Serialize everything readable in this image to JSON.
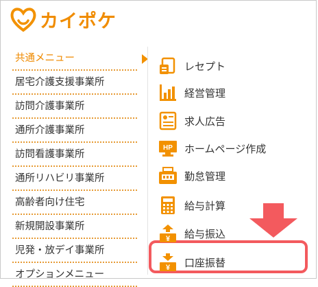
{
  "app": {
    "brand": "カイポケ"
  },
  "colors": {
    "accent": "#f08c00",
    "highlight": "#f35a5e",
    "icon_orange": "#f29100"
  },
  "sidebar": {
    "items": [
      {
        "label": "共通メニュー",
        "active": true
      },
      {
        "label": "居宅介護支援事業所"
      },
      {
        "label": "訪問介護事業所"
      },
      {
        "label": "通所介護事業所"
      },
      {
        "label": "訪問看護事業所"
      },
      {
        "label": "通所リハビリ事業所"
      },
      {
        "label": "高齢者向け住宅"
      },
      {
        "label": "新規開設事業所"
      },
      {
        "label": "児発・放デイ事業所"
      },
      {
        "label": "オプションメニュー"
      }
    ]
  },
  "submenu": {
    "items": [
      {
        "label": "レセプト",
        "icon": "receipt-icon"
      },
      {
        "label": "経営管理",
        "icon": "bar-chart-icon"
      },
      {
        "label": "求人広告",
        "icon": "job-ad-icon"
      },
      {
        "label": "ホームページ作成",
        "icon": "homepage-icon"
      },
      {
        "label": "勤怠管理",
        "icon": "time-clock-icon"
      },
      {
        "label": "給与計算",
        "icon": "calculator-icon"
      },
      {
        "label": "給与振込",
        "icon": "salary-transfer-icon"
      },
      {
        "label": "口座振替",
        "icon": "account-transfer-icon",
        "highlighted": true
      }
    ],
    "hp_badge": "HP",
    "yen_mark": "¥"
  }
}
